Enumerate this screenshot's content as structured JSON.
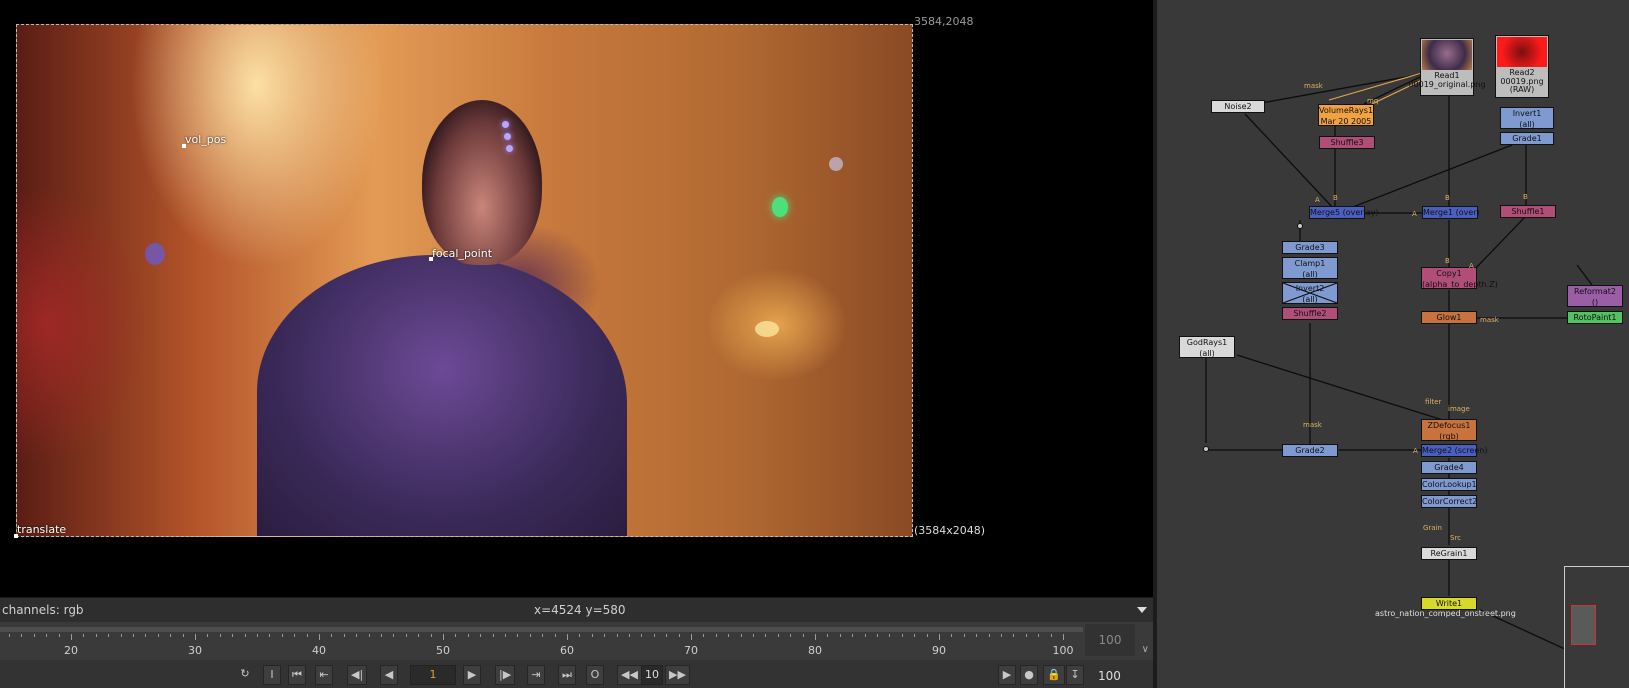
{
  "viewer": {
    "frame_top_right": "3584,2048",
    "frame_bottom_right": "(3584x2048)",
    "overlays": {
      "vol_pos": "vol_pos",
      "focal_point": "focal_point",
      "translate": "translate"
    },
    "status": {
      "channels": "channels: rgb",
      "cursor": "x=4524 y=580"
    }
  },
  "timeline": {
    "ticks": [
      "20",
      "30",
      "40",
      "50",
      "60",
      "70",
      "80",
      "90",
      "100"
    ],
    "end_frame": "100"
  },
  "transport": {
    "in_label": "I",
    "current_frame": "1",
    "out_label": "O",
    "increment": "10",
    "fps": "100"
  },
  "nodegraph": {
    "nodes": {
      "read1": {
        "title": "Read1",
        "file": "00019_original.png"
      },
      "read2": {
        "title": "Read2",
        "file": "00019.png",
        "file2": "(RAW)"
      },
      "noise2": "Noise2",
      "volumerays1": {
        "title": "VolumeRays1",
        "sub": "Mar 20 2005"
      },
      "shuffle3": "Shuffle3",
      "invert1": {
        "title": "Invert1",
        "sub": "(all)"
      },
      "grade1": "Grade1",
      "merge5": "Merge5 (overlay)",
      "merge1": "Merge1 (over)",
      "shuffle1": "Shuffle1",
      "grade3": "Grade3",
      "clamp1": {
        "title": "Clamp1",
        "sub": "(all)"
      },
      "invert2": {
        "title": "Invert2",
        "sub": "(all)"
      },
      "shuffle2": "Shuffle2",
      "copy1": {
        "title": "Copy1",
        "sub": "(alpha_to_depth.Z)"
      },
      "reformat2": {
        "title": "Reformat2",
        "sub": "()"
      },
      "glow1": "Glow1",
      "rotopaint1": "RotoPaint1",
      "godrays1": {
        "title": "GodRays1",
        "sub": "(all)"
      },
      "zdefocus1": {
        "title": "ZDefocus1",
        "sub": "(rgb)"
      },
      "grade2": "Grade2",
      "merge_screen": "Merge2 (screen)",
      "grade4": "Grade4",
      "colorlookup1": "ColorLookup1",
      "colorcorrect2": "ColorCorrect2",
      "regrain1": "ReGrain1",
      "write1": {
        "title": "Write1",
        "file": "astro_nation_comped_onstreet.png"
      }
    },
    "edge_labels": {
      "mask1": "mask",
      "mq": "mq",
      "a1": "A",
      "b1": "B",
      "a2": "A",
      "b2": "B",
      "b3": "B",
      "b4": "B",
      "a3": "A",
      "mask2": "mask",
      "filter": "filter",
      "image": "image",
      "mask3": "mask",
      "a4": "A",
      "grain": "Grain",
      "src": "Src"
    }
  },
  "colors": {
    "viewer_bg": "#000000",
    "nodegraph_bg": "#393939",
    "accent_orange": "#e0a030"
  }
}
